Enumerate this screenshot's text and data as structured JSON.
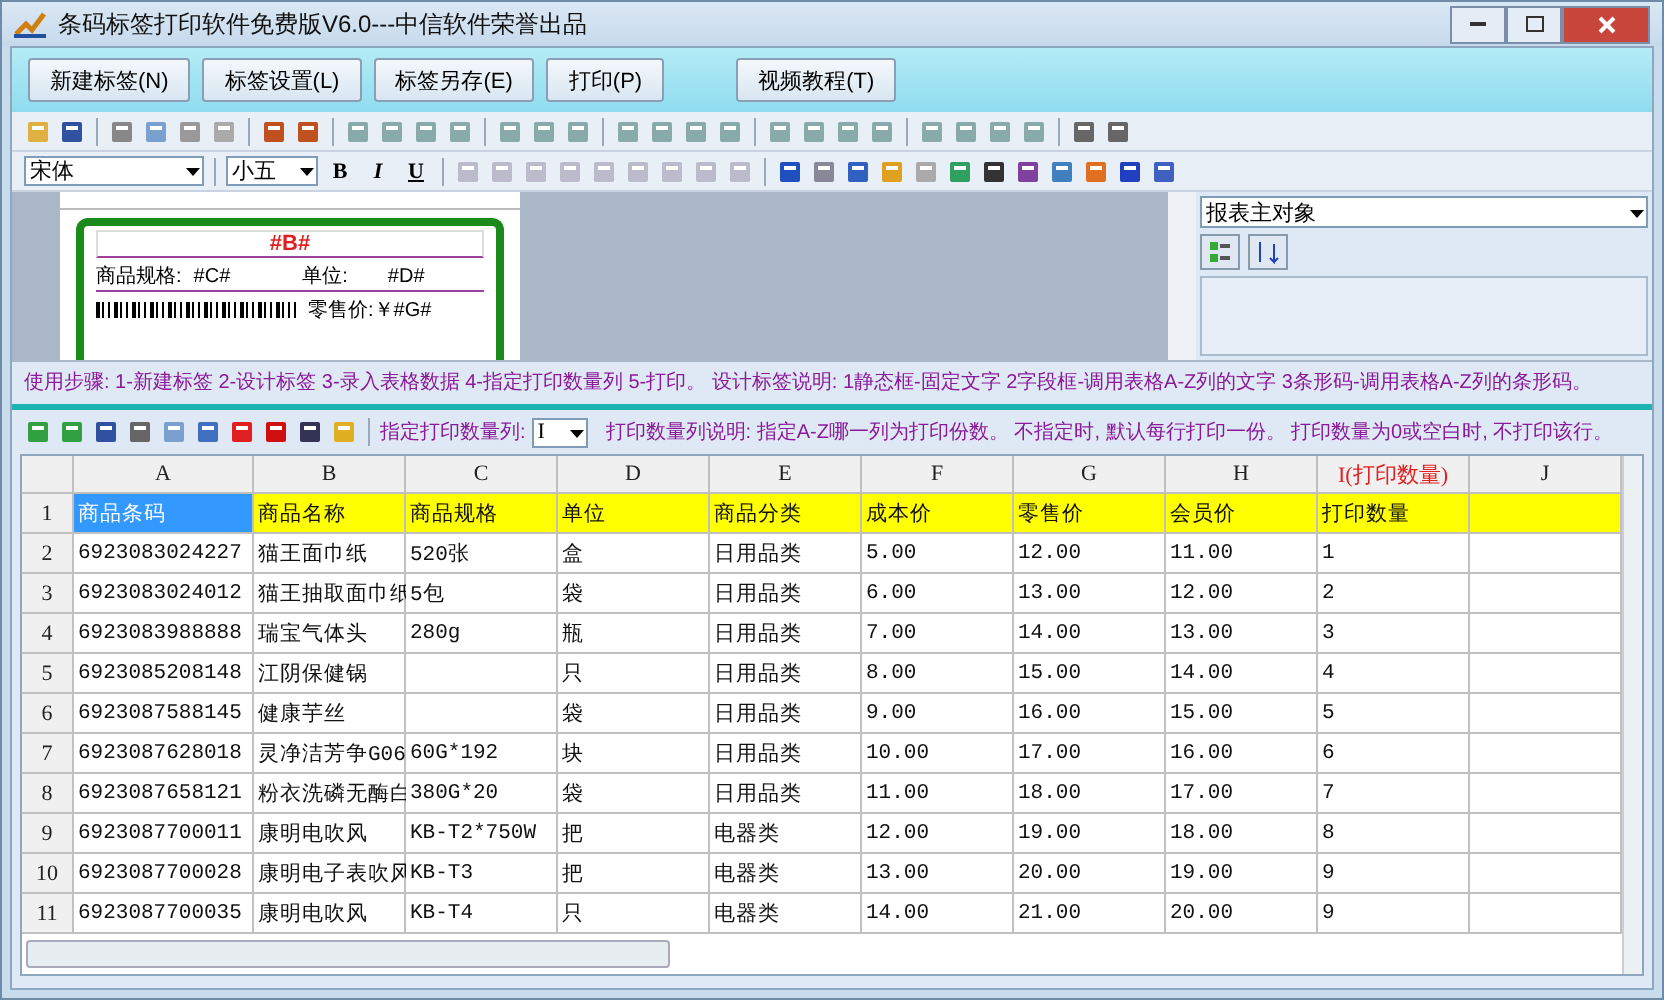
{
  "window": {
    "title": "条码标签打印软件免费版V6.0---中信软件荣誉出品"
  },
  "main_buttons": [
    "新建标签(N)",
    "标签设置(L)",
    "标签另存(E)",
    "打印(P)",
    "视频教程(T)"
  ],
  "font_bar": {
    "font": "宋体",
    "size": "小五",
    "bold": "B",
    "italic": "I",
    "underline": "U"
  },
  "label_preview": {
    "title": "#B#",
    "spec_label": "商品规格:",
    "spec_value": "#C#",
    "unit_label": "单位:",
    "unit_value": "#D#",
    "price_label": "零售价:￥#G#"
  },
  "properties": {
    "object": "报表主对象"
  },
  "steps_text": "使用步骤: 1-新建标签 2-设计标签 3-录入表格数据 4-指定打印数量列 5-打印。 设计标签说明: 1静态框-固定文字 2字段框-调用表格A-Z列的文字 3条形码-调用表格A-Z列的条形码。",
  "grid_toolbar": {
    "print_column_label": "指定打印数量列:",
    "print_column": "I",
    "note": "打印数量列说明: 指定A-Z哪一列为打印份数。 不指定时, 默认每行打印一份。 打印数量为0或空白时, 不打印该行。"
  },
  "table": {
    "columns": [
      {
        "label": "A",
        "print_column": false
      },
      {
        "label": "B",
        "print_column": false
      },
      {
        "label": "C",
        "print_column": false
      },
      {
        "label": "D",
        "print_column": false
      },
      {
        "label": "E",
        "print_column": false
      },
      {
        "label": "F",
        "print_column": false
      },
      {
        "label": "G",
        "print_column": false
      },
      {
        "label": "H",
        "print_column": false
      },
      {
        "label": "I(打印数量)",
        "print_column": true
      },
      {
        "label": "J",
        "print_column": false
      }
    ],
    "rows": [
      {
        "number": "1",
        "header": true,
        "first_cell_selected": true,
        "cells": [
          "商品条码",
          "商品名称",
          "商品规格",
          "单位",
          "商品分类",
          "成本价",
          "零售价",
          "会员价",
          "打印数量",
          null
        ]
      },
      {
        "number": "2",
        "header": false,
        "first_cell_selected": false,
        "cells": [
          "6923083024227",
          "猫王面巾纸",
          "520张",
          "盒",
          "日用品类",
          "5.00",
          "12.00",
          "11.00",
          "1",
          null
        ]
      },
      {
        "number": "3",
        "header": false,
        "first_cell_selected": false,
        "cells": [
          "6923083024012",
          "猫王抽取面巾纸",
          "5包",
          "袋",
          "日用品类",
          "6.00",
          "13.00",
          "12.00",
          "2",
          null
        ]
      },
      {
        "number": "4",
        "header": false,
        "first_cell_selected": false,
        "cells": [
          "6923083988888",
          "瑞宝气体头",
          "280g",
          "瓶",
          "日用品类",
          "7.00",
          "14.00",
          "13.00",
          "3",
          null
        ]
      },
      {
        "number": "5",
        "header": false,
        "first_cell_selected": false,
        "cells": [
          "6923085208148",
          "江阴保健锅",
          null,
          "只",
          "日用品类",
          "8.00",
          "15.00",
          "14.00",
          "4",
          null
        ]
      },
      {
        "number": "6",
        "header": false,
        "first_cell_selected": false,
        "cells": [
          "6923087588145",
          "健康芋丝",
          null,
          "袋",
          "日用品类",
          "9.00",
          "16.00",
          "15.00",
          "5",
          null
        ]
      },
      {
        "number": "7",
        "header": false,
        "first_cell_selected": false,
        "cells": [
          "6923087628018",
          "灵净洁芳争G06",
          "60G*192",
          "块",
          "日用品类",
          "10.00",
          "17.00",
          "16.00",
          "6",
          null
        ]
      },
      {
        "number": "8",
        "header": false,
        "first_cell_selected": false,
        "cells": [
          "6923087658121",
          "粉衣洗磷无酶白",
          "380G*20",
          "袋",
          "日用品类",
          "11.00",
          "18.00",
          "17.00",
          "7",
          null
        ]
      },
      {
        "number": "9",
        "header": false,
        "first_cell_selected": false,
        "cells": [
          "6923087700011",
          "康明电吹风",
          "KB-T2*750W",
          "把",
          "电器类",
          "12.00",
          "19.00",
          "18.00",
          "8",
          null
        ]
      },
      {
        "number": "10",
        "header": false,
        "first_cell_selected": false,
        "cells": [
          "6923087700028",
          "康明电子表吹风",
          "KB-T3",
          "把",
          "电器类",
          "13.00",
          "20.00",
          "19.00",
          "9",
          null
        ]
      },
      {
        "number": "11",
        "header": false,
        "first_cell_selected": false,
        "cells": [
          "6923087700035",
          "康明电吹风",
          "KB-T4",
          "只",
          "电器类",
          "14.00",
          "21.00",
          "20.00",
          "9",
          null
        ]
      }
    ]
  }
}
